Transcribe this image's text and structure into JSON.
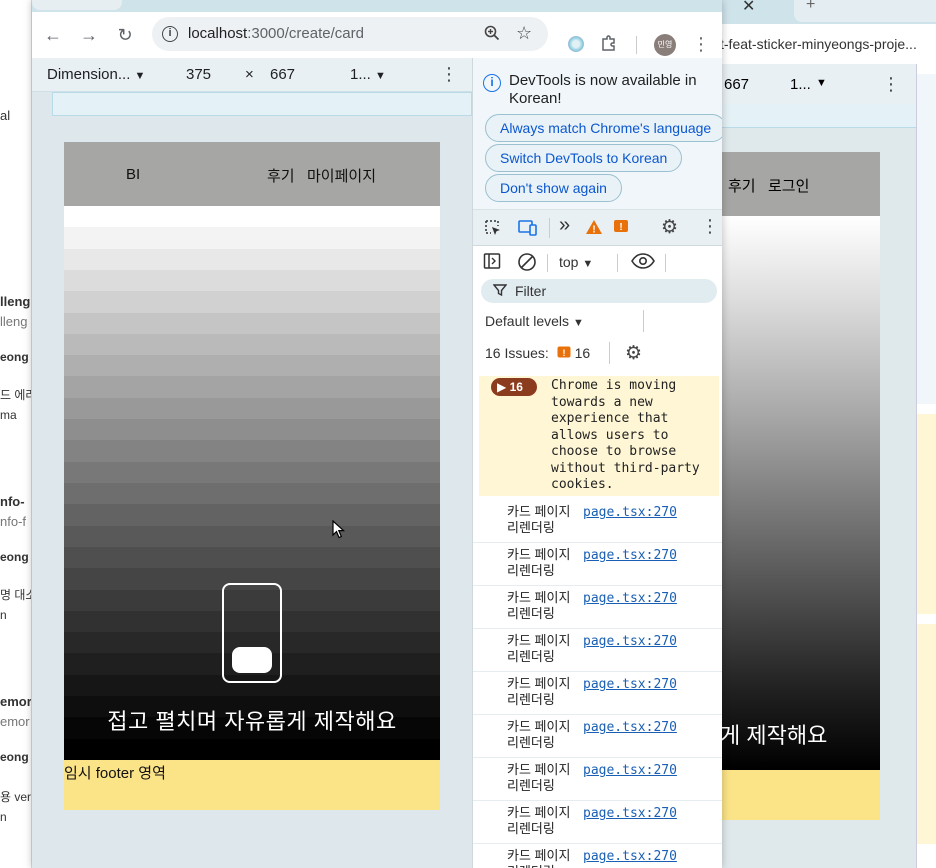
{
  "browser": {
    "url_host": "localhost",
    "url_path": ":3000/create/card",
    "avatar_label": "민영",
    "colors": {
      "accent": "#1a73e8",
      "toolbar_bg": "#ffffff",
      "frame_bg": "#dee8ec"
    }
  },
  "background_left": {
    "items": [
      "al",
      "lleng",
      "lleng",
      "eong",
      "드 에러",
      "ma",
      "nfo-",
      "nfo-f",
      "eong",
      "명 대소",
      "n",
      "emor",
      "emor",
      "eong",
      "용 ver",
      "n"
    ]
  },
  "background_right": {
    "url_fragment": "t-feat-sticker-minyeongs-proje...",
    "dim_height": "667",
    "zoom": "1...",
    "nav_review": "후기",
    "nav_login": "로그인",
    "hero_text": "게 제작해요"
  },
  "device_toolbar": {
    "dimensions_label": "Dimension...",
    "width": "375",
    "times": "×",
    "height": "667",
    "zoom": "1..."
  },
  "site": {
    "logo": "BI",
    "nav_review": "후기",
    "nav_mypage": "마이페이지",
    "hero_text": "접고 펼치며 자유롭게 제작해요",
    "footer_text": "임시 footer 영역",
    "colors": {
      "header_bg": "#a6a6a4",
      "footer_bg": "#fbe387"
    }
  },
  "devtools": {
    "lang_message": "DevTools is now available in Korean!",
    "btn_always": "Always match Chrome's language",
    "btn_switch": "Switch DevTools to Korean",
    "btn_dont_show": "Don't show again",
    "context": "top",
    "filter_placeholder": "Filter",
    "levels": "Default levels",
    "issues_label": "16 Issues:",
    "issues_count": "16",
    "issue_badge": "16",
    "issue_message": "Chrome is moving towards a new experience that allows users to choose to browse without third-party cookies.",
    "logs": [
      {
        "msg": "카드 페이지 리렌더링",
        "link": "page.tsx:270"
      },
      {
        "msg": "카드 페이지 리렌더링",
        "link": "page.tsx:270"
      },
      {
        "msg": "카드 페이지 리렌더링",
        "link": "page.tsx:270"
      },
      {
        "msg": "카드 페이지 리렌더링",
        "link": "page.tsx:270"
      },
      {
        "msg": "카드 페이지 리렌더링",
        "link": "page.tsx:270"
      },
      {
        "msg": "카드 페이지 리렌더링",
        "link": "page.tsx:270"
      },
      {
        "msg": "카드 페이지 리렌더링",
        "link": "page.tsx:270"
      },
      {
        "msg": "카드 페이지 리렌더링",
        "link": "page.tsx:270"
      },
      {
        "msg": "카드 페이지 리렌더링",
        "link": "page.tsx:270"
      }
    ]
  }
}
